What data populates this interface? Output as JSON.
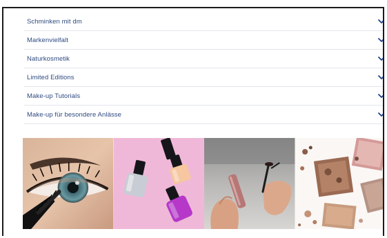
{
  "accordion": {
    "items": [
      {
        "label": "Schminken mit dm"
      },
      {
        "label": "Markenvielfalt"
      },
      {
        "label": "Naturkosmetik"
      },
      {
        "label": "Limited Editions"
      },
      {
        "label": "Make-up Tutorials"
      },
      {
        "label": "Make-up für besondere Anlässe"
      }
    ],
    "chevron_icon": "chevron-down-icon"
  },
  "gallery": {
    "images": [
      {
        "name": "eye-mascara-image"
      },
      {
        "name": "nail-polish-image"
      },
      {
        "name": "lipgloss-image"
      },
      {
        "name": "eyeshadow-image"
      }
    ]
  },
  "colors": {
    "link_blue": "#2f4a80",
    "chevron_blue": "#1f3f8f",
    "divider": "#e2e5ea",
    "pink_bg": "#f0b8d8"
  }
}
